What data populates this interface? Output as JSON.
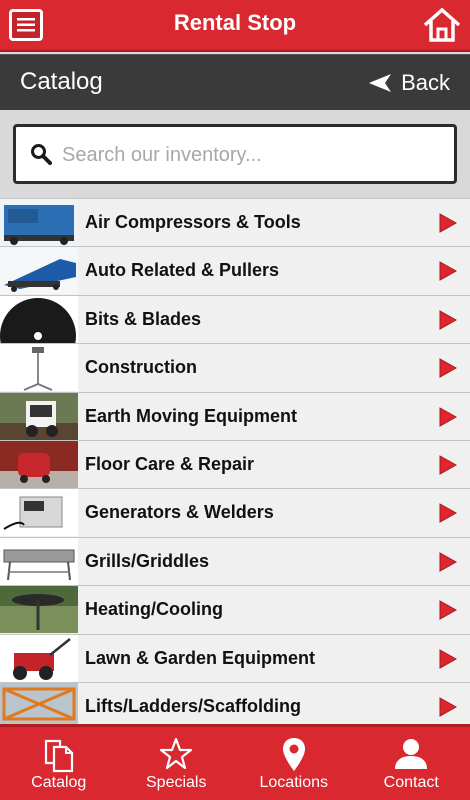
{
  "header": {
    "title": "Rental Stop",
    "menu_icon": "menu-icon",
    "home_icon": "home-icon"
  },
  "subheader": {
    "title": "Catalog",
    "back_label": "Back"
  },
  "search": {
    "placeholder": "Search our inventory..."
  },
  "categories": [
    {
      "label": "Air Compressors & Tools"
    },
    {
      "label": "Auto Related & Pullers"
    },
    {
      "label": "Bits & Blades"
    },
    {
      "label": "Construction"
    },
    {
      "label": "Earth Moving Equipment"
    },
    {
      "label": "Floor Care & Repair"
    },
    {
      "label": "Generators & Welders"
    },
    {
      "label": "Grills/Griddles"
    },
    {
      "label": "Heating/Cooling"
    },
    {
      "label": "Lawn & Garden Equipment"
    },
    {
      "label": "Lifts/Ladders/Scaffolding"
    }
  ],
  "tabs": [
    {
      "label": "Catalog",
      "icon": "documents-icon"
    },
    {
      "label": "Specials",
      "icon": "star-icon"
    },
    {
      "label": "Locations",
      "icon": "map-pin-icon"
    },
    {
      "label": "Contact",
      "icon": "person-icon"
    }
  ],
  "colors": {
    "brand_red": "#d9282f",
    "dark_bar": "#3a3a3a",
    "arrow_red": "#e0262d"
  }
}
